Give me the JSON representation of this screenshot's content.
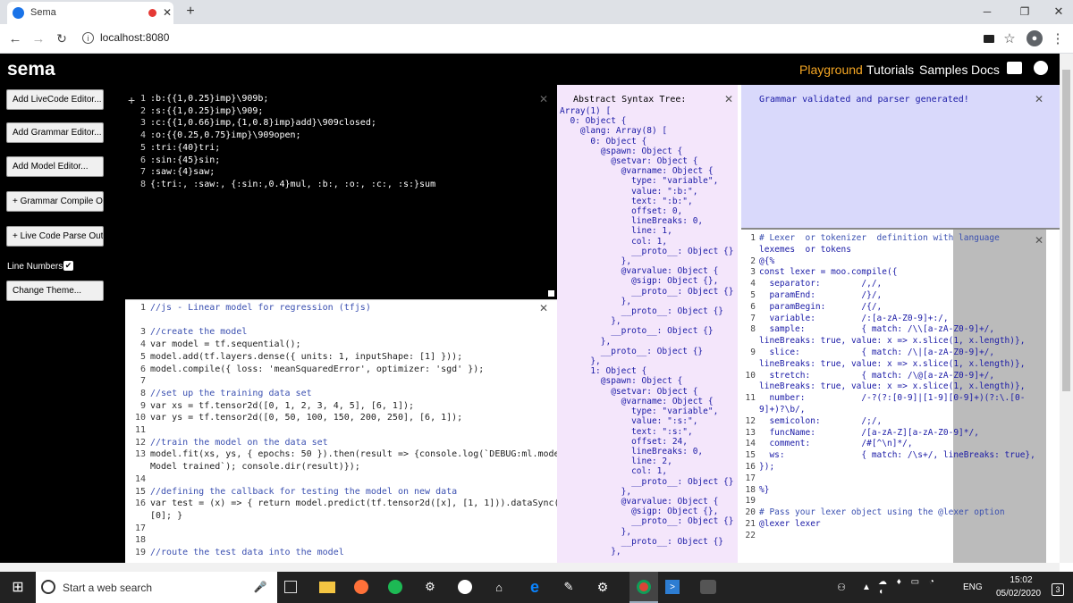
{
  "browser": {
    "tab_title": "Sema",
    "url": "localhost:8080"
  },
  "app": {
    "logo": "sema",
    "nav": [
      "Playground",
      "Tutorials",
      "Samples",
      "Docs"
    ],
    "accent": "#f5a623"
  },
  "sidebar": {
    "buttons": [
      "Add LiveCode Editor...",
      "Add Grammar Editor...",
      "Add Model Editor...",
      "+ Grammar Compile Out",
      "+ Live Code Parse Out"
    ],
    "line_numbers_label": "Line Numbers",
    "change_theme_label": "Change Theme..."
  },
  "editor1": {
    "lines": [
      ":b:{{1,0.25}imp}\\909b;",
      ":s:{{1,0.25}imp}\\909;",
      ":c:{{1,0.66}imp,{1,0.8}imp}add}\\909closed;",
      ":o:{{0.25,0.75}imp}\\909open;",
      ":tri:{40}tri;",
      ":sin:{45}sin;",
      ":saw:{4}saw;",
      "{:tri:, :saw:, {:sin:,0.4}mul, :b:, :o:, :c:, :s:}sum"
    ]
  },
  "editor2": {
    "lines": [
      "//js - Linear model for regression (tfjs)",
      "",
      "//create the model",
      "var model = tf.sequential();",
      "model.add(tf.layers.dense({ units: 1, inputShape: [1] }));",
      "model.compile({ loss: 'meanSquaredError', optimizer: 'sgd' });",
      "",
      "//set up the training data set",
      "var xs = tf.tensor2d([0, 1, 2, 3, 4, 5], [6, 1]);",
      "var ys = tf.tensor2d([0, 50, 100, 150, 200, 250], [6, 1]);",
      "",
      "//train the model on the data set",
      "model.fit(xs, ys, { epochs: 50 }).then(result => {console.log(`DEBUG:ml.model:",
      "Model trained`); console.dir(result)});",
      "",
      "//defining the callback for testing the model on new data",
      "var test = (x) => { return model.predict(tf.tensor2d([x], [1, 1])).dataSync()",
      "[0]; }",
      "",
      "",
      "//route the test data into the model"
    ],
    "line_numbers": [
      "1",
      "",
      "3",
      "4",
      "5",
      "6",
      "7",
      "8",
      "9",
      "10",
      "11",
      "12",
      "13",
      "",
      "14",
      "15",
      "16",
      "",
      "17",
      "18",
      "19"
    ]
  },
  "ast": {
    "title": "Abstract Syntax Tree:",
    "lines": [
      "Array(1) [",
      "  0: Object {",
      "    @lang: Array(8) [",
      "      0: Object {",
      "        @spawn: Object {",
      "          @setvar: Object {",
      "            @varname: Object {",
      "              type: \"variable\",",
      "              value: \":b:\",",
      "              text: \":b:\",",
      "              offset: 0,",
      "              lineBreaks: 0,",
      "              line: 1,",
      "              col: 1,",
      "              __proto__: Object {}",
      "            },",
      "            @varvalue: Object {",
      "              @sigp: Object {},",
      "              __proto__: Object {}",
      "            },",
      "            __proto__: Object {}",
      "          },",
      "          __proto__: Object {}",
      "        },",
      "        __proto__: Object {}",
      "      },",
      "      1: Object {",
      "        @spawn: Object {",
      "          @setvar: Object {",
      "            @varname: Object {",
      "              type: \"variable\",",
      "              value: \":s:\",",
      "              text: \":s:\",",
      "              offset: 24,",
      "              lineBreaks: 0,",
      "              line: 2,",
      "              col: 1,",
      "              __proto__: Object {}",
      "            },",
      "            @varvalue: Object {",
      "              @sigp: Object {},",
      "              __proto__: Object {}",
      "            },",
      "            __proto__: Object {}",
      "          },"
    ]
  },
  "grammar_msg": "Grammar validated and parser generated!",
  "grammar_editor": {
    "lines": [
      {
        "n": "1",
        "t": "# Lexer  or tokenizer  definition with language"
      },
      {
        "n": "",
        "t": "lexemes  or tokens"
      },
      {
        "n": "2",
        "t": "@{%"
      },
      {
        "n": "3",
        "t": "const lexer = moo.compile({"
      },
      {
        "n": "4",
        "t": "  separator:        /,/,"
      },
      {
        "n": "5",
        "t": "  paramEnd:         /}/,"
      },
      {
        "n": "6",
        "t": "  paramBegin:       /{/,"
      },
      {
        "n": "7",
        "t": "  variable:         /:[a-zA-Z0-9]+:/,"
      },
      {
        "n": "8",
        "t": "  sample:           { match: /\\\\[a-zA-Z0-9]+/,"
      },
      {
        "n": "",
        "t": "lineBreaks: true, value: x => x.slice(1, x.length)},"
      },
      {
        "n": "9",
        "t": "  slice:            { match: /\\|[a-zA-Z0-9]+/,"
      },
      {
        "n": "",
        "t": "lineBreaks: true, value: x => x.slice(1, x.length)},"
      },
      {
        "n": "10",
        "t": "  stretch:          { match: /\\@[a-zA-Z0-9]+/,"
      },
      {
        "n": "",
        "t": "lineBreaks: true, value: x => x.slice(1, x.length)},"
      },
      {
        "n": "11",
        "t": "  number:           /-?(?:[0-9]|[1-9][0-9]+)(?:\\.[0-"
      },
      {
        "n": "",
        "t": "9]+)?\\b/,"
      },
      {
        "n": "12",
        "t": "  semicolon:        /;/,"
      },
      {
        "n": "13",
        "t": "  funcName:         /[a-zA-Z][a-zA-Z0-9]*/,"
      },
      {
        "n": "14",
        "t": "  comment:          /#[^\\n]*/,"
      },
      {
        "n": "15",
        "t": "  ws:               { match: /\\s+/, lineBreaks: true},"
      },
      {
        "n": "16",
        "t": "});"
      },
      {
        "n": "17",
        "t": ""
      },
      {
        "n": "18",
        "t": "%}"
      },
      {
        "n": "19",
        "t": ""
      },
      {
        "n": "20",
        "t": "# Pass your lexer object using the @lexer option"
      },
      {
        "n": "21",
        "t": "@lexer lexer"
      },
      {
        "n": "22",
        "t": ""
      }
    ]
  },
  "taskbar": {
    "search_placeholder": "Start a web search",
    "lang": "ENG",
    "time": "15:02",
    "date": "05/02/2020",
    "notif_count": "3"
  }
}
